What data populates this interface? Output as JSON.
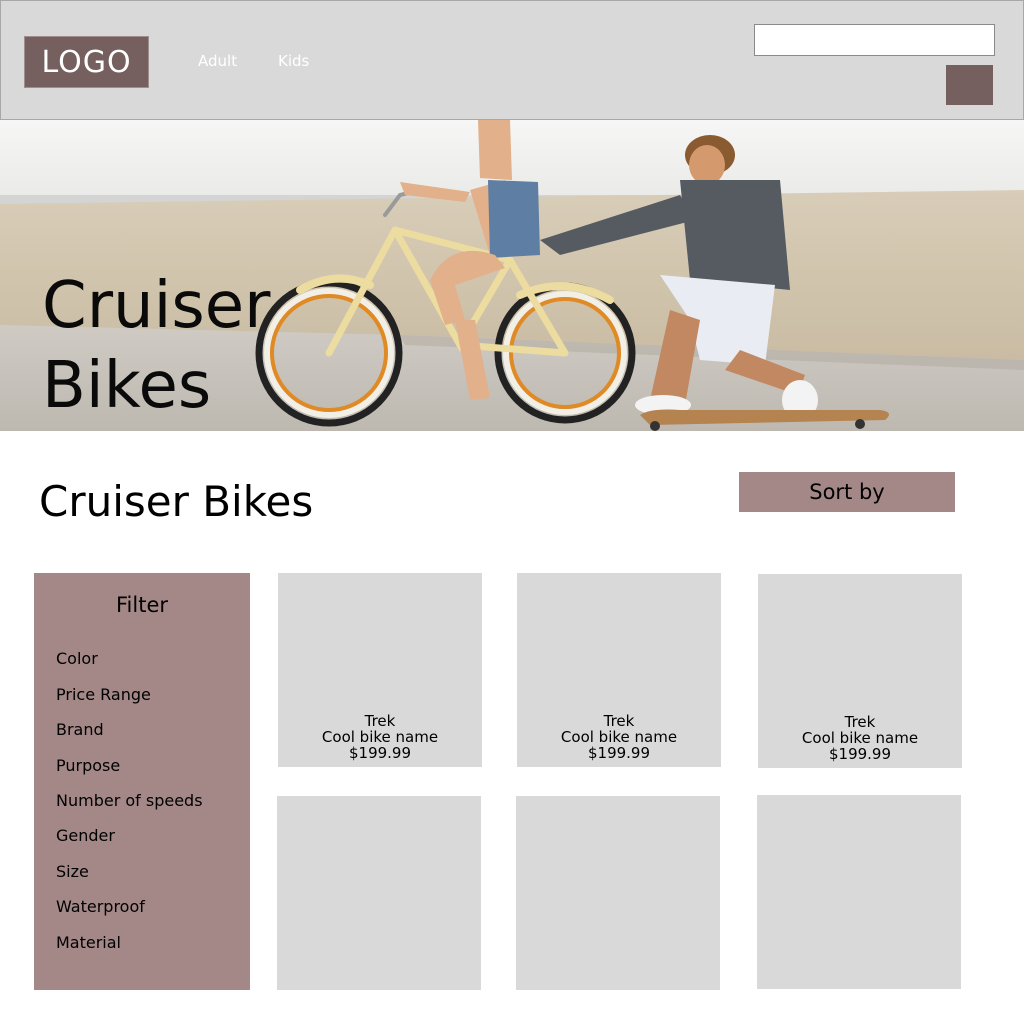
{
  "header": {
    "logo": "LOGO",
    "nav": [
      "Adult",
      "Kids"
    ],
    "search": {
      "value": "",
      "placeholder": ""
    }
  },
  "hero": {
    "title_line1": "Cruiser",
    "title_line2": "Bikes",
    "image_icon": "photo-beach-cruiser-bike-skateboard"
  },
  "main": {
    "title": "Cruiser Bikes",
    "sort_label": "Sort by"
  },
  "filter": {
    "title": "Filter",
    "items": [
      "Color",
      "Price Range",
      "Brand",
      "Purpose",
      "Number of speeds",
      "Gender",
      "Size",
      "Waterproof",
      "Material"
    ]
  },
  "products": [
    {
      "brand": "Trek",
      "name": "Cool bike name",
      "price": "$199.99"
    },
    {
      "brand": "Trek",
      "name": "Cool bike name",
      "price": "$199.99"
    },
    {
      "brand": "Trek",
      "name": "Cool bike name",
      "price": "$199.99"
    },
    {
      "brand": "",
      "name": "",
      "price": ""
    },
    {
      "brand": "",
      "name": "",
      "price": ""
    },
    {
      "brand": "",
      "name": "",
      "price": ""
    }
  ],
  "colors": {
    "header_bg": "#d9d9d9",
    "logo_bg": "#76605f",
    "accent_rose": "#a48887",
    "card_bg": "#d9d9d9"
  }
}
